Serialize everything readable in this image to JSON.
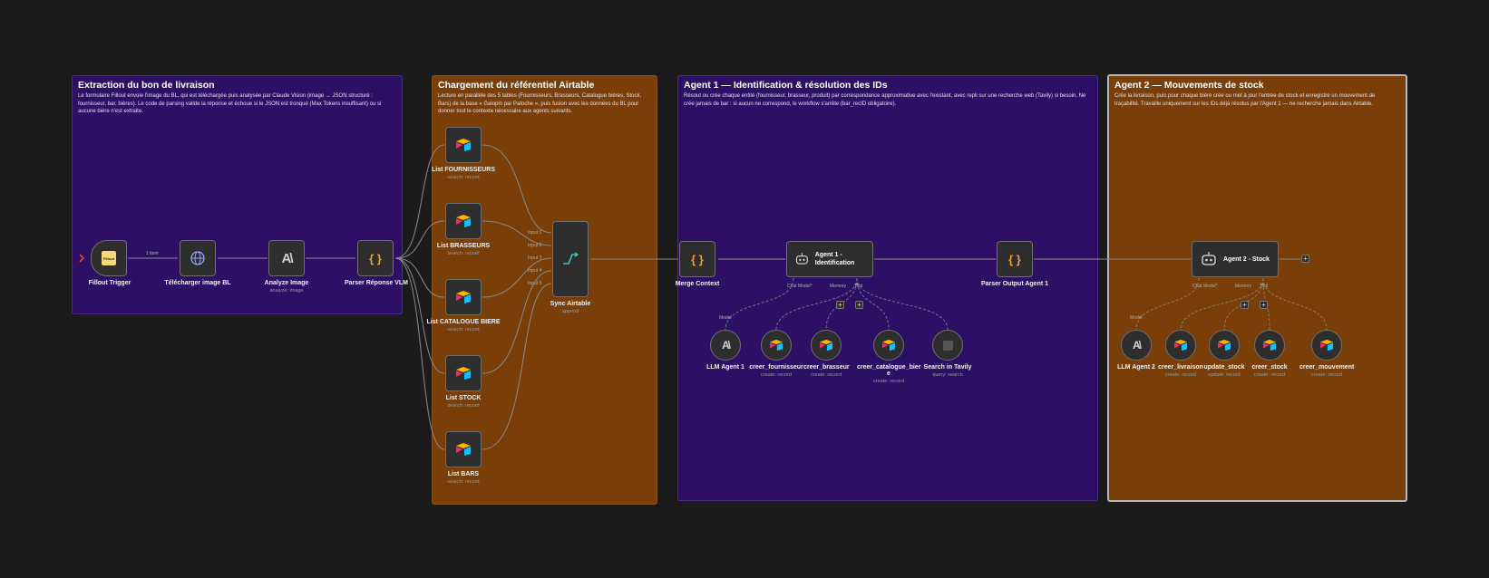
{
  "stickies": [
    {
      "title": "Extraction du bon de livraison",
      "text": "Le formulaire Fillout envoie l'image du BL, qui est téléchargée puis analysée par Claude Vision (image → JSON structuré : fournisseur, bar, bières). Le code de parsing valide la réponse et échoue si le JSON est tronqué (Max Tokens insuffisant) ou si aucune bière n'est extraite."
    },
    {
      "title": "Chargement du référentiel Airtable",
      "text": "Lecture en parallèle des 5 tables (Fournisseurs, Brasseurs, Catalogue bières, Stock, Bars) de la base « Galopin par Patoche », puis fusion avec les données du BL pour donner tout le contexte nécessaire aux agents suivants."
    },
    {
      "title": "Agent 1 — Identification & résolution des IDs",
      "text": "Résout ou crée chaque entité (fournisseur, brasseur, produit) par correspondance approximative avec l'existant, avec repli sur une recherche web (Tavily) si besoin. Ne crée jamais de bar : si aucun ne correspond, le workflow s'arrête (bar_recID obligatoire)."
    },
    {
      "title": "Agent 2 — Mouvements de stock",
      "text": "Crée la livraison, puis pour chaque bière crée ou met à jour l'entrée de stock et enregistre un mouvement de traçabilité. Travaille uniquement sur les IDs déjà résolus par l'Agent 1 — ne recherche jamais dans Airtable."
    }
  ],
  "nodes": {
    "fillout": {
      "label": "Fillout Trigger",
      "icon_text": "Fillout"
    },
    "telecharger": {
      "label": "Télécharger image BL"
    },
    "analyze": {
      "label": "Analyze Image",
      "sub": "analyze: image"
    },
    "parser_vlm": {
      "label": "Parser Réponse VLM"
    },
    "list_fournisseurs": {
      "label": "List FOURNISSEURS",
      "sub": "search: record"
    },
    "list_brasseurs": {
      "label": "List BRASSEURS",
      "sub": "search: record"
    },
    "list_catalogue": {
      "label": "List CATALOGUE BIERE",
      "sub": "search: record"
    },
    "list_stock": {
      "label": "List STOCK",
      "sub": "search: record"
    },
    "list_bars": {
      "label": "List BARS",
      "sub": "search: record"
    },
    "sync": {
      "label": "Sync Airtable",
      "sub": "append",
      "inputs": [
        "Input 1",
        "Input 2",
        "Input 3",
        "Input 4",
        "Input 5"
      ]
    },
    "merge": {
      "label": "Merge Context"
    },
    "agent1": {
      "label": "Agent 1 - Identification",
      "ports": [
        "Chat Model*",
        "Memory",
        "Tool"
      ]
    },
    "parser_agent1": {
      "label": "Parser Output Agent 1"
    },
    "agent2": {
      "label": "Agent 2 - Stock",
      "ports": [
        "Chat Model*",
        "Memory",
        "Tool"
      ]
    },
    "llm_agent1": {
      "label": "LLM Agent 1",
      "port_label": "Model"
    },
    "creer_fournisseur": {
      "label": "creer_fournisseur",
      "sub": "create: record"
    },
    "creer_brasseur": {
      "label": "creer_brasseur",
      "sub": "create: record"
    },
    "creer_catalogue_biere": {
      "label1": "creer_catalogue_bier",
      "label2": "e",
      "sub": "create: record"
    },
    "search_tavily": {
      "label": "Search in Tavily",
      "sub": "query: search"
    },
    "llm_agent2": {
      "label": "LLM Agent 2",
      "port_label": "Model"
    },
    "creer_livraison": {
      "label": "creer_livraison",
      "sub": "create: record"
    },
    "update_stock": {
      "label": "update_stock",
      "sub": "update: record"
    },
    "creer_stock": {
      "label": "creer_stock",
      "sub": "create: record"
    },
    "creer_mouvement": {
      "label": "creer_mouvement",
      "sub": "create: record"
    }
  },
  "edges": {
    "item_count": "1 item"
  },
  "colors": {
    "canvas": "#1b1b1b",
    "sticky_purple": "#2d0f66",
    "sticky_orange": "#7a3f08",
    "airtable_yellow": "#fcb400",
    "airtable_blue": "#18bfff",
    "airtable_red": "#f82b60",
    "code_orange": "#f0a030"
  }
}
